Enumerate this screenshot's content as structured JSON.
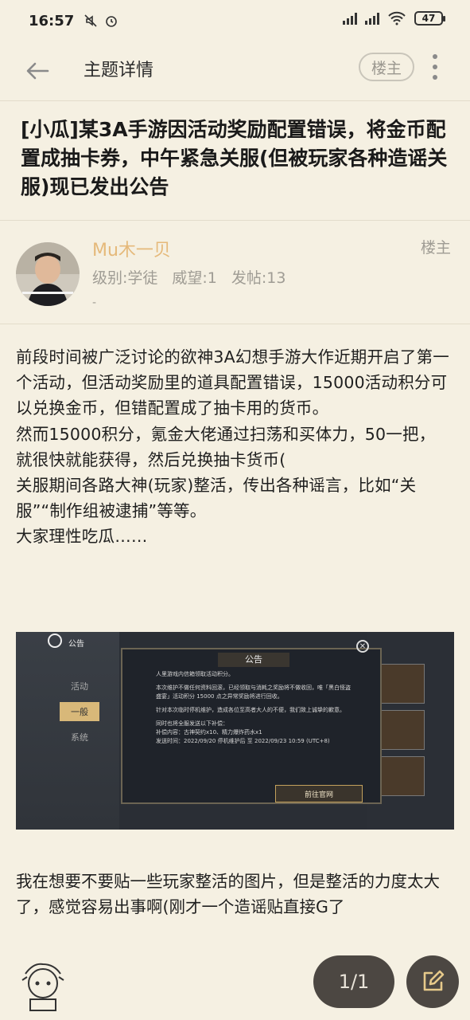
{
  "status_bar": {
    "time": "16:57",
    "battery": "47"
  },
  "header": {
    "title": "主题详情",
    "op_pill": "楼主"
  },
  "thread": {
    "title": "[小瓜]某3A手游因活动奖励配置错误，将金币配置成抽卡券，中午紧急关服(但被玩家各种造谣关服)现已发出公告"
  },
  "author": {
    "name": "Mu木一贝",
    "level": "级别:学徒",
    "prestige": "威望:1",
    "posts": "发帖:13",
    "extra": "-",
    "floor_label": "楼主"
  },
  "post": {
    "paragraphs": [
      "前段时间被广泛讨论的欲神3A幻想手游大作近期开启了第一个活动，但活动奖励里的道具配置错误，15000活动积分可以兑换金币，但错配置成了抽卡用的货币。",
      "然而15000积分，氪金大佬通过扫荡和买体力，50一把，就很快就能获得，然后兑换抽卡货币(",
      "关服期间各路大神(玩家)整活，传出各种谣言，比如“关服”“制作组被逮捕”等等。",
      "大家理性吃瓜……"
    ],
    "after_image": "我在想要不要贴一些玩家整活的图片，但是整活的力度太大了，感觉容易出事啊(刚才一个造谣贴直接G了"
  },
  "embedded_image": {
    "back_label": "公告",
    "tabs": [
      "活动",
      "一般",
      "系统"
    ],
    "dialog_title": "公告",
    "dialog_lines": [
      "人里游戏内信箱领取活动积分。",
      "本次维护不做任何资料回滚，已经领取与消耗之奖励将不做收回，唯「黑白怪盗盛宴」活动积分 15000 点之异常奖励将进行回收。",
      "针对本次临时停机维护，造成各位至高者大人的不便，我们致上诚挚的歉意。",
      "同时也将全服发送以下补偿：",
      "补偿内容：古神契约x10、精力爆炸药水x1",
      "发送时间：2022/09/20 停机维护后 至 2022/09/23 10:59 (UTC+8)"
    ],
    "dialog_button": "前往官网"
  },
  "pagination": "1/1"
}
